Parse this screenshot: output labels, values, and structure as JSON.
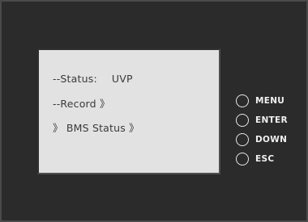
{
  "display": {
    "status_label": "--Status:",
    "status_value": "UVP",
    "record_item": "--Record 》",
    "bms_item": "》 BMS Status 》"
  },
  "buttons": [
    {
      "label": "MENU",
      "icon": "circle-button-icon"
    },
    {
      "label": "ENTER",
      "icon": "circle-button-icon"
    },
    {
      "label": "DOWN",
      "icon": "circle-button-icon"
    },
    {
      "label": "ESC",
      "icon": "circle-button-icon"
    }
  ],
  "colors": {
    "panel": "#2b2b2b",
    "screen": "#e2e2e2",
    "screen_text": "#3a3a3a",
    "button_text": "#f0f0f0"
  }
}
